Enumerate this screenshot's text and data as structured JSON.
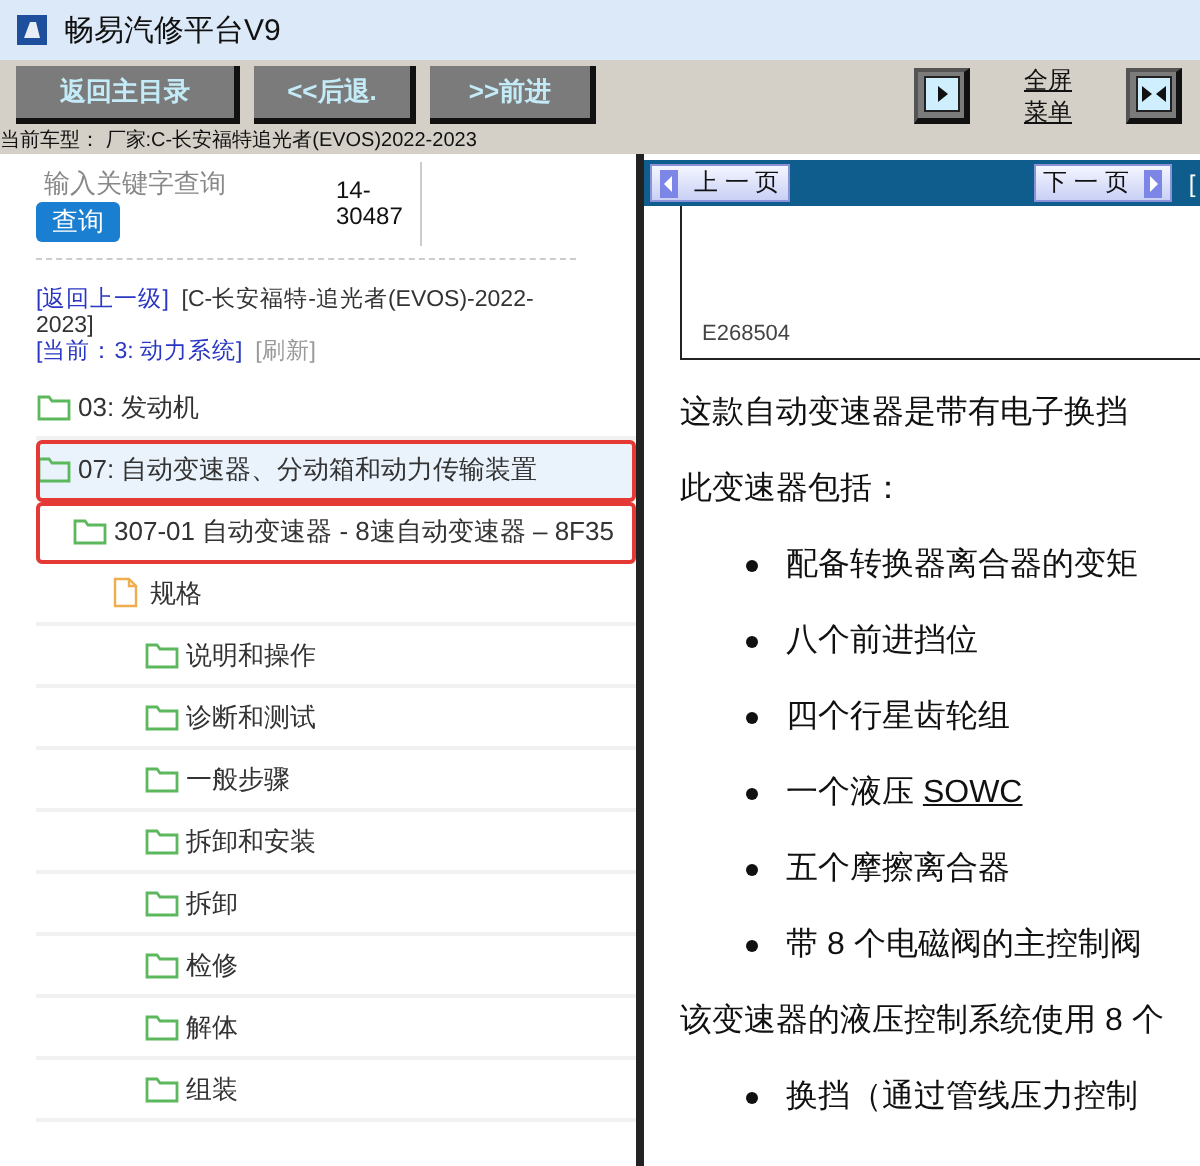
{
  "window": {
    "title": "畅易汽修平台V9"
  },
  "toolbar": {
    "buttons": [
      "返回主目录",
      "<<后退.",
      ">>前进"
    ],
    "fullscreen_menu": [
      "全屏",
      "菜单"
    ]
  },
  "vehicle_line": "当前车型： 厂家:C-长安福特追光者(EVOS)2022-2023",
  "search": {
    "placeholder": "输入关键字查询",
    "button": "查询",
    "code": "14-30487"
  },
  "breadcrumb": {
    "back_link": "[返回上一级]",
    "vehicle": "[C-长安福特-追光者(EVOS)-2022-2023]",
    "current": "[当前：3: 动力系统]",
    "refresh": "[刷新]"
  },
  "tree": [
    {
      "label": "03: 发动机",
      "kind": "folder",
      "selected": false,
      "highlighted": false
    },
    {
      "label": "07: 自动变速器、分动箱和动力传输装置",
      "kind": "folder",
      "selected": true,
      "highlighted": true,
      "children": [
        {
          "label": "307-01 自动变速器 - 8速自动变速器 – 8F35",
          "kind": "folder",
          "selected": false,
          "highlighted": true,
          "children": [
            {
              "label": "规格",
              "kind": "file",
              "selected": false,
              "highlighted": false,
              "children": [
                {
                  "label": "说明和操作",
                  "kind": "folder",
                  "selected": false,
                  "highlighted": false
                },
                {
                  "label": "诊断和测试",
                  "kind": "folder",
                  "selected": false,
                  "highlighted": false
                },
                {
                  "label": "一般步骤",
                  "kind": "folder",
                  "selected": false,
                  "highlighted": false
                },
                {
                  "label": "拆卸和安装",
                  "kind": "folder",
                  "selected": false,
                  "highlighted": false
                },
                {
                  "label": "拆卸",
                  "kind": "folder",
                  "selected": false,
                  "highlighted": false
                },
                {
                  "label": "检修",
                  "kind": "folder",
                  "selected": false,
                  "highlighted": false
                },
                {
                  "label": "解体",
                  "kind": "folder",
                  "selected": false,
                  "highlighted": false
                },
                {
                  "label": "组装",
                  "kind": "folder",
                  "selected": false,
                  "highlighted": false
                }
              ]
            }
          ]
        }
      ]
    }
  ],
  "viewer": {
    "prev": "上 一 页",
    "next": "下 一 页",
    "edge": "[",
    "figure_caption": "E268504",
    "content": [
      {
        "kind": "paragraph",
        "text": "这款自动变速器是带有电子换挡"
      },
      {
        "kind": "paragraph",
        "text": "此变速器包括："
      },
      {
        "kind": "bullet",
        "text": "配备转换器离合器的变矩"
      },
      {
        "kind": "bullet",
        "text": "八个前进挡位"
      },
      {
        "kind": "bullet",
        "text": "四个行星齿轮组"
      },
      {
        "kind": "bullet",
        "text": "一个液压",
        "link": "SOWC"
      },
      {
        "kind": "bullet",
        "text": "五个摩擦离合器"
      },
      {
        "kind": "bullet",
        "text": "带 8 个电磁阀的主控制阀"
      },
      {
        "kind": "paragraph",
        "text": "该变速器的液压控制系统使用 8 个"
      },
      {
        "kind": "bullet",
        "text": "换挡（通过管线压力控制"
      }
    ]
  }
}
